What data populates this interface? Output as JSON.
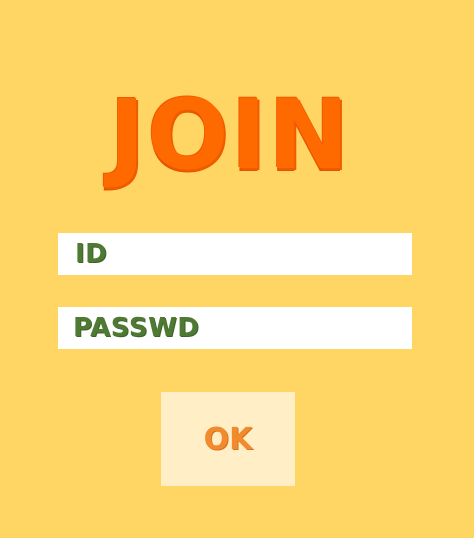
{
  "screen": {
    "title": "JOIN"
  },
  "form": {
    "id_field": {
      "label": "ID",
      "value": ""
    },
    "password_field": {
      "label": "PASSWD",
      "value": ""
    },
    "submit": {
      "label": "OK"
    }
  },
  "colors": {
    "background": "#FFD664",
    "title": "#FF6A00",
    "field_label": "#4E7A34",
    "button_background": "#FFEEC6",
    "button_label": "#F28A2E"
  }
}
